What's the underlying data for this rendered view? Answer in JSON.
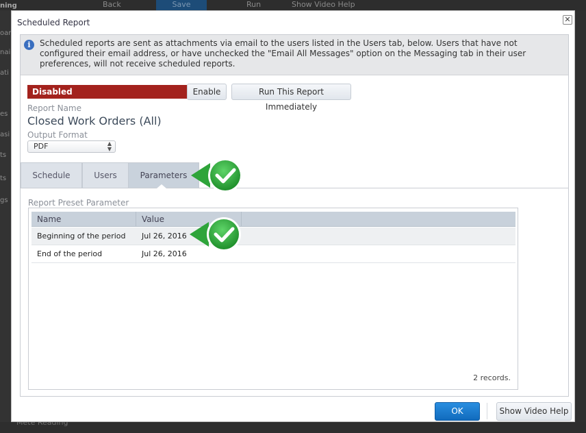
{
  "background": {
    "toolbar": {
      "back": "Back",
      "save": "Save",
      "run": "Run",
      "video_help": "Show Video Help"
    },
    "sidebar_fragments": [
      "ning",
      "oar",
      "nai",
      "ati",
      "es",
      "asi",
      "ts",
      "ts",
      "gs"
    ],
    "bottom_fragment": "Mete Reading"
  },
  "dialog": {
    "title": "Scheduled Report",
    "close_glyph": "✕",
    "info_icon": "info-icon",
    "info_text": "Scheduled reports are sent as attachments via email to the users listed in the Users tab, below. Users that have not configured their email address, or have unchecked the \"Email All Messages\" option on the Messaging tab in their user preferences, will not receive scheduled reports.",
    "status": "Disabled",
    "enable_label": "Enable",
    "run_label": "Run This Report Immediately",
    "report_name_label": "Report Name",
    "report_name": "Closed Work Orders (All)",
    "output_format_label": "Output Format",
    "output_format_value": "PDF",
    "tabs": [
      {
        "label": "Schedule",
        "active": false
      },
      {
        "label": "Users",
        "active": false
      },
      {
        "label": "Parameters",
        "active": true
      }
    ],
    "preset_label": "Report Preset Parameter",
    "grid": {
      "columns": [
        "Name",
        "Value"
      ],
      "rows": [
        {
          "name": "Beginning of the period",
          "value": "Jul 26, 2016"
        },
        {
          "name": "End of the period",
          "value": "Jul 26, 2016"
        }
      ],
      "records": "2 records."
    },
    "ok_label": "OK",
    "help_label": "Show Video Help"
  },
  "colors": {
    "status_red": "#a3221d",
    "ok_blue": "#1a7fd4",
    "check_green": "#2ea43a"
  }
}
